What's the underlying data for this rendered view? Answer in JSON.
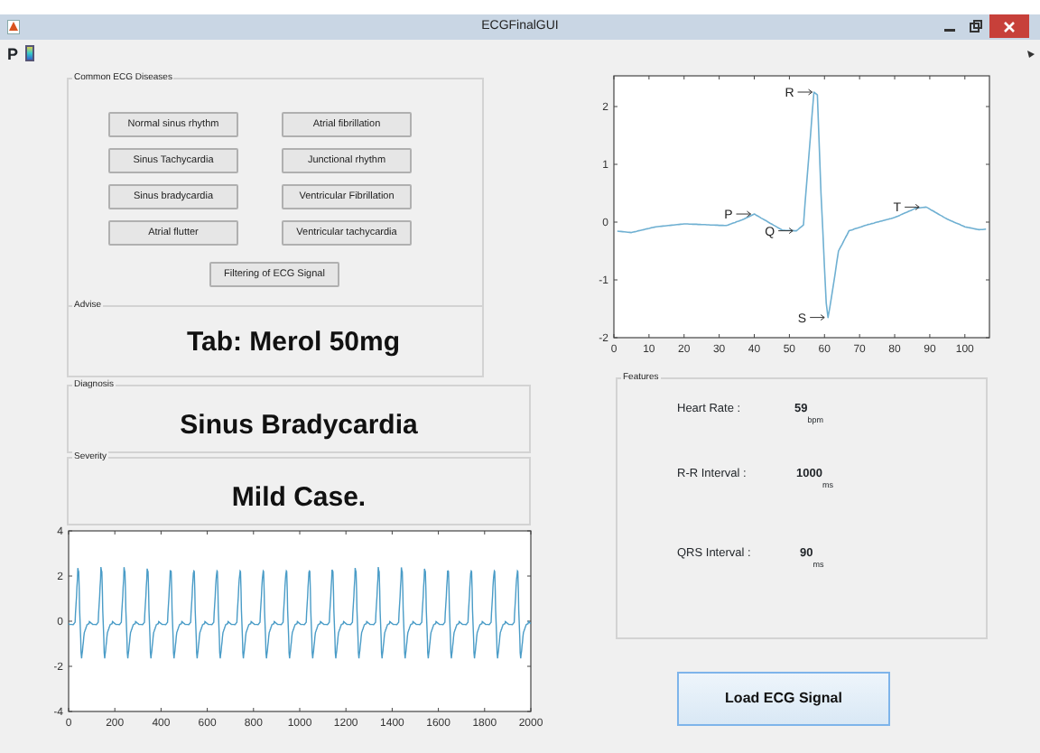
{
  "window": {
    "title": "ECGFinalGUI"
  },
  "toolbar": {
    "items": [
      {
        "kind": "text",
        "label": "P"
      },
      {
        "kind": "colorbar"
      }
    ]
  },
  "diseases_panel": {
    "title": "Common ECG Diseases",
    "buttons": [
      {
        "label": "Normal sinus rhythm"
      },
      {
        "label": "Atrial fibrillation"
      },
      {
        "label": "Sinus Tachycardia"
      },
      {
        "label": "Junctional rhythm"
      },
      {
        "label": "Sinus bradycardia"
      },
      {
        "label": "Ventricular Fibrillation"
      },
      {
        "label": "Atrial flutter"
      },
      {
        "label": "Ventricular tachycardia"
      }
    ],
    "filter_button": "Filtering of ECG Signal"
  },
  "advise": {
    "title": "Advise",
    "text": "Tab: Merol 50mg"
  },
  "diagnosis": {
    "title": "Diagnosis",
    "text": "Sinus Bradycardia"
  },
  "severity": {
    "title": "Severity",
    "text": "Mild Case."
  },
  "beat_chart": {
    "x_tick_labels": [
      "0",
      "10",
      "20",
      "30",
      "40",
      "50",
      "60",
      "70",
      "80",
      "90",
      "100"
    ],
    "y_tick_labels": [
      "2",
      "1",
      "0",
      "-1",
      "-2"
    ],
    "peak_labels": [
      "P",
      "Q",
      "R",
      "S",
      "T"
    ]
  },
  "signal_chart": {
    "x_tick_labels": [
      "0",
      "200",
      "400",
      "600",
      "800",
      "1000",
      "1200",
      "1400",
      "1600",
      "1800",
      "2000"
    ],
    "y_tick_labels": [
      "4",
      "2",
      "0",
      "-2",
      "-4"
    ]
  },
  "features": {
    "title": "Features",
    "rows": [
      {
        "label": "Heart Rate :",
        "value": "59",
        "unit": "bpm"
      },
      {
        "label": "R-R Interval :",
        "value": "1000",
        "unit": "ms"
      },
      {
        "label": "QRS Interval :",
        "value": "90",
        "unit": "ms"
      }
    ]
  },
  "load_button": "Load ECG Signal"
}
